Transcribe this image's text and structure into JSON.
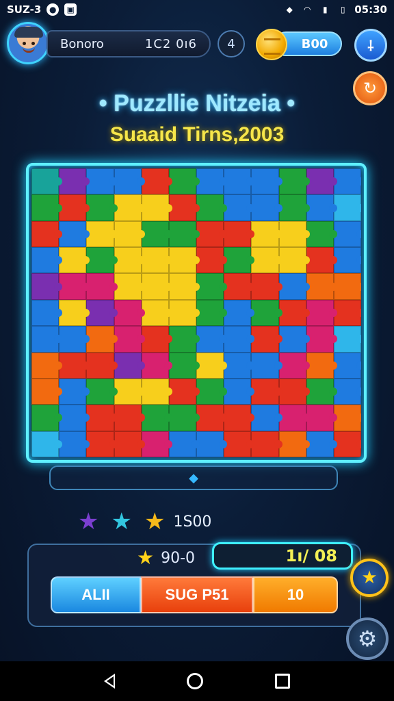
{
  "status": {
    "left_text": "SUZ-3",
    "time": "05:30"
  },
  "player": {
    "name": "Bonoro",
    "score": "1C2 0ı6"
  },
  "level_icon": "4",
  "coins": {
    "value": "B00"
  },
  "title": "Puzzllie Nitzeia",
  "subtitle": "Suaaid Tirns,2003",
  "board": {
    "cols": 12,
    "rows": 11,
    "colors": {
      "r": "#e4321f",
      "o": "#f26a10",
      "y": "#f7cf1c",
      "g": "#1fa33a",
      "b": "#1f7be0",
      "c": "#2fb6ea",
      "p": "#7a2fb0",
      "m": "#d8216f",
      "t": "#18a39a"
    },
    "layout": [
      "tpbbrgbbbgpb",
      "grgyyrgbbgbc",
      "rbyyggrryygb",
      "bygyyyrgyyrb",
      "pmmyyygrrboo",
      "bypmyygbgrmr",
      "bbomrgbbrbmc",
      "orrpmgybbmob",
      "obgyyrgbrrgb",
      "gbrrggrrbmmo",
      "cbrrmbbrrobr"
    ]
  },
  "stars_score": "1S00",
  "best_score": "90-0",
  "progress_text": "1ı/ 08",
  "buttons": {
    "all": "ALΙI",
    "sug": "SUG P51",
    "count": "10"
  },
  "icons": {
    "wifi": "wifi-icon",
    "signal": "signal-icon",
    "battery": "battery-icon",
    "settings": "settings-icon",
    "refresh": "refresh-icon",
    "hint": "hint-icon",
    "gear": "gear-icon"
  }
}
